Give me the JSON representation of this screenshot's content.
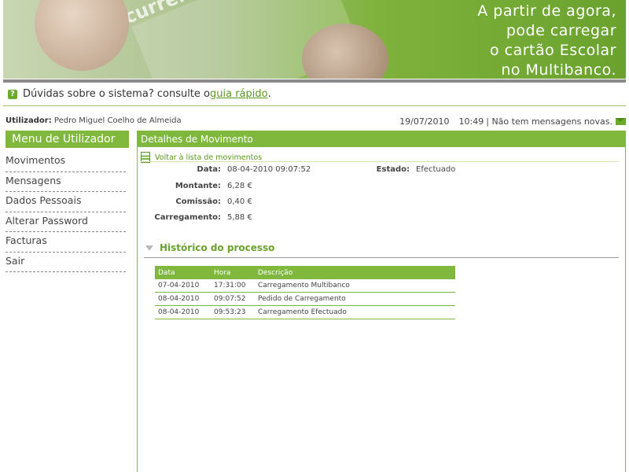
{
  "banner": {
    "slogan_lines": [
      "A partir de agora,",
      "pode carregar",
      "o cartão Escolar",
      "no Multibanco."
    ],
    "card_text": "currenta Integrada Gestão de Escolas"
  },
  "help": {
    "text": "Dúvidas sobre o sistema? consulte o ",
    "link": "guia rápido",
    "after": "."
  },
  "user": {
    "label": "Utilizador:",
    "name": "Pedro Miguel Coelho de Almeida"
  },
  "status": {
    "date": "19/07/2010",
    "time": "10:49",
    "messages": "| Não tem mensagens novas."
  },
  "menu": {
    "title": "Menu de Utilizador",
    "items": [
      "Movimentos",
      "Mensagens",
      "Dados Pessoais",
      "Alterar Password",
      "Facturas",
      "Sair"
    ]
  },
  "details": {
    "title": "Detalhes de Movimento",
    "back_link": "Voltar à lista de movimentos",
    "fields": {
      "data_label": "Data:",
      "data_value": "08-04-2010 09:07:52",
      "estado_label": "Estado:",
      "estado_value": "Efectuado",
      "montante_label": "Montante:",
      "montante_value": "6,28 €",
      "comissao_label": "Comissão:",
      "comissao_value": "0,40 €",
      "carregamento_label": "Carregamento:",
      "carregamento_value": "5,88 €"
    },
    "history_title": "Histórico do processo",
    "table": {
      "headers": [
        "Data",
        "Hora",
        "Descrição"
      ],
      "rows": [
        [
          "07-04-2010",
          "17:31:00",
          "Carregamento Multibanco"
        ],
        [
          "08-04-2010",
          "09:07:52",
          "Pedido de Carregamento"
        ],
        [
          "08-04-2010",
          "09:53:23",
          "Carregamento Efectuado"
        ]
      ]
    }
  },
  "colors": {
    "accent": "#7fb83c",
    "link": "#5a9a1e",
    "title_green": "#6aa22e"
  }
}
